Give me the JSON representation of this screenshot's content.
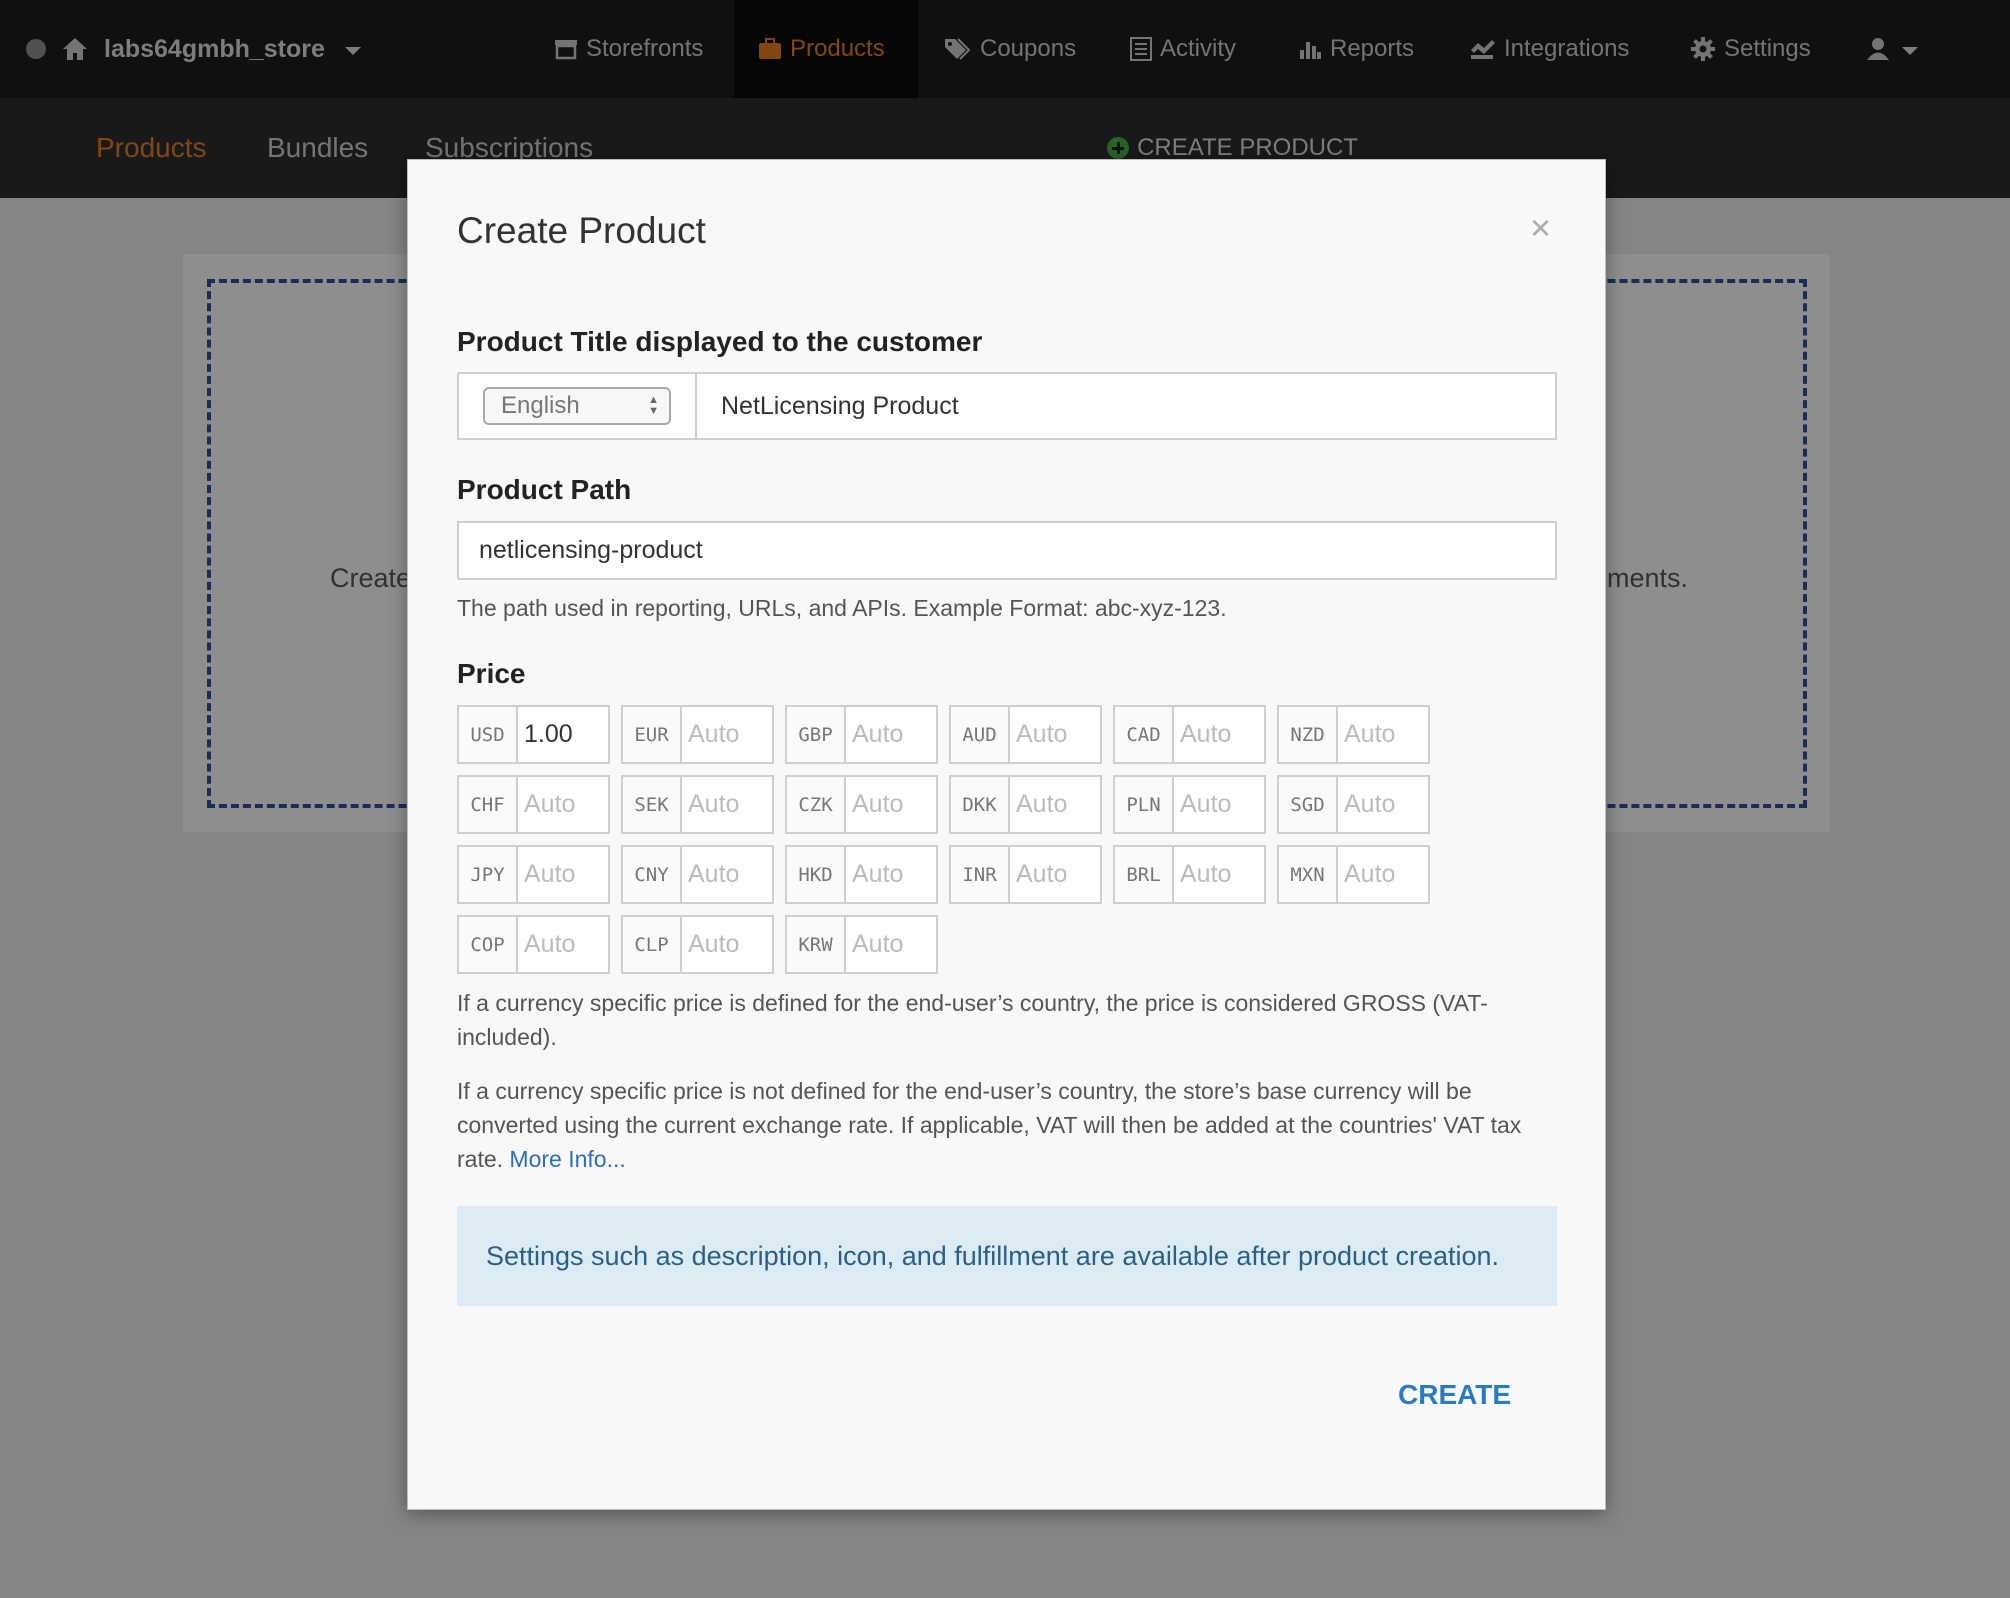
{
  "topbar": {
    "store_name": "labs64gmbh_store",
    "nav": [
      {
        "label": "Storefronts",
        "icon": "storefront-icon"
      },
      {
        "label": "Products",
        "icon": "briefcase-icon",
        "active": true
      },
      {
        "label": "Coupons",
        "icon": "tags-icon"
      },
      {
        "label": "Activity",
        "icon": "list-icon"
      },
      {
        "label": "Reports",
        "icon": "bar-chart-icon"
      },
      {
        "label": "Integrations",
        "icon": "integrations-icon"
      },
      {
        "label": "Settings",
        "icon": "gear-icon"
      }
    ],
    "user_icon": "user-icon",
    "accent_color": "#e07b1d"
  },
  "subnav": {
    "tabs": [
      {
        "label": "Products",
        "active": true
      },
      {
        "label": "Bundles"
      },
      {
        "label": "Subscriptions"
      }
    ],
    "create_label": "CREATE PRODUCT"
  },
  "background": {
    "text_left": "Create",
    "text_right": "ments."
  },
  "modal": {
    "title": "Create Product",
    "close": "×",
    "title_label": "Product Title displayed to the customer",
    "language": "English",
    "product_title": "NetLicensing Product",
    "path_label": "Product Path",
    "path_value": "netlicensing-product",
    "path_help": "The path used in reporting, URLs, and APIs. Example Format: abc-xyz-123.",
    "price_label": "Price",
    "prices": [
      {
        "code": "USD",
        "value": "1.00"
      },
      {
        "code": "EUR",
        "placeholder": "Auto"
      },
      {
        "code": "GBP",
        "placeholder": "Auto"
      },
      {
        "code": "AUD",
        "placeholder": "Auto"
      },
      {
        "code": "CAD",
        "placeholder": "Auto"
      },
      {
        "code": "NZD",
        "placeholder": "Auto"
      },
      {
        "code": "CHF",
        "placeholder": "Auto"
      },
      {
        "code": "SEK",
        "placeholder": "Auto"
      },
      {
        "code": "CZK",
        "placeholder": "Auto"
      },
      {
        "code": "DKK",
        "placeholder": "Auto"
      },
      {
        "code": "PLN",
        "placeholder": "Auto"
      },
      {
        "code": "SGD",
        "placeholder": "Auto"
      },
      {
        "code": "JPY",
        "placeholder": "Auto"
      },
      {
        "code": "CNY",
        "placeholder": "Auto"
      },
      {
        "code": "HKD",
        "placeholder": "Auto"
      },
      {
        "code": "INR",
        "placeholder": "Auto"
      },
      {
        "code": "BRL",
        "placeholder": "Auto"
      },
      {
        "code": "MXN",
        "placeholder": "Auto"
      },
      {
        "code": "COP",
        "placeholder": "Auto"
      },
      {
        "code": "CLP",
        "placeholder": "Auto"
      },
      {
        "code": "KRW",
        "placeholder": "Auto"
      }
    ],
    "gross_note": "If a currency specific price is defined for the end-user’s country, the price is considered GROSS (VAT-included).",
    "convert_note": "If a currency specific price is not defined for the end-user’s country, the store’s base currency will be converted using the current exchange rate. If applicable, VAT will then be added at the countries' VAT tax rate.",
    "more_info": "More Info...",
    "info_box": "Settings such as description, icon, and fulfillment are available after product creation.",
    "create_button": "CREATE"
  }
}
